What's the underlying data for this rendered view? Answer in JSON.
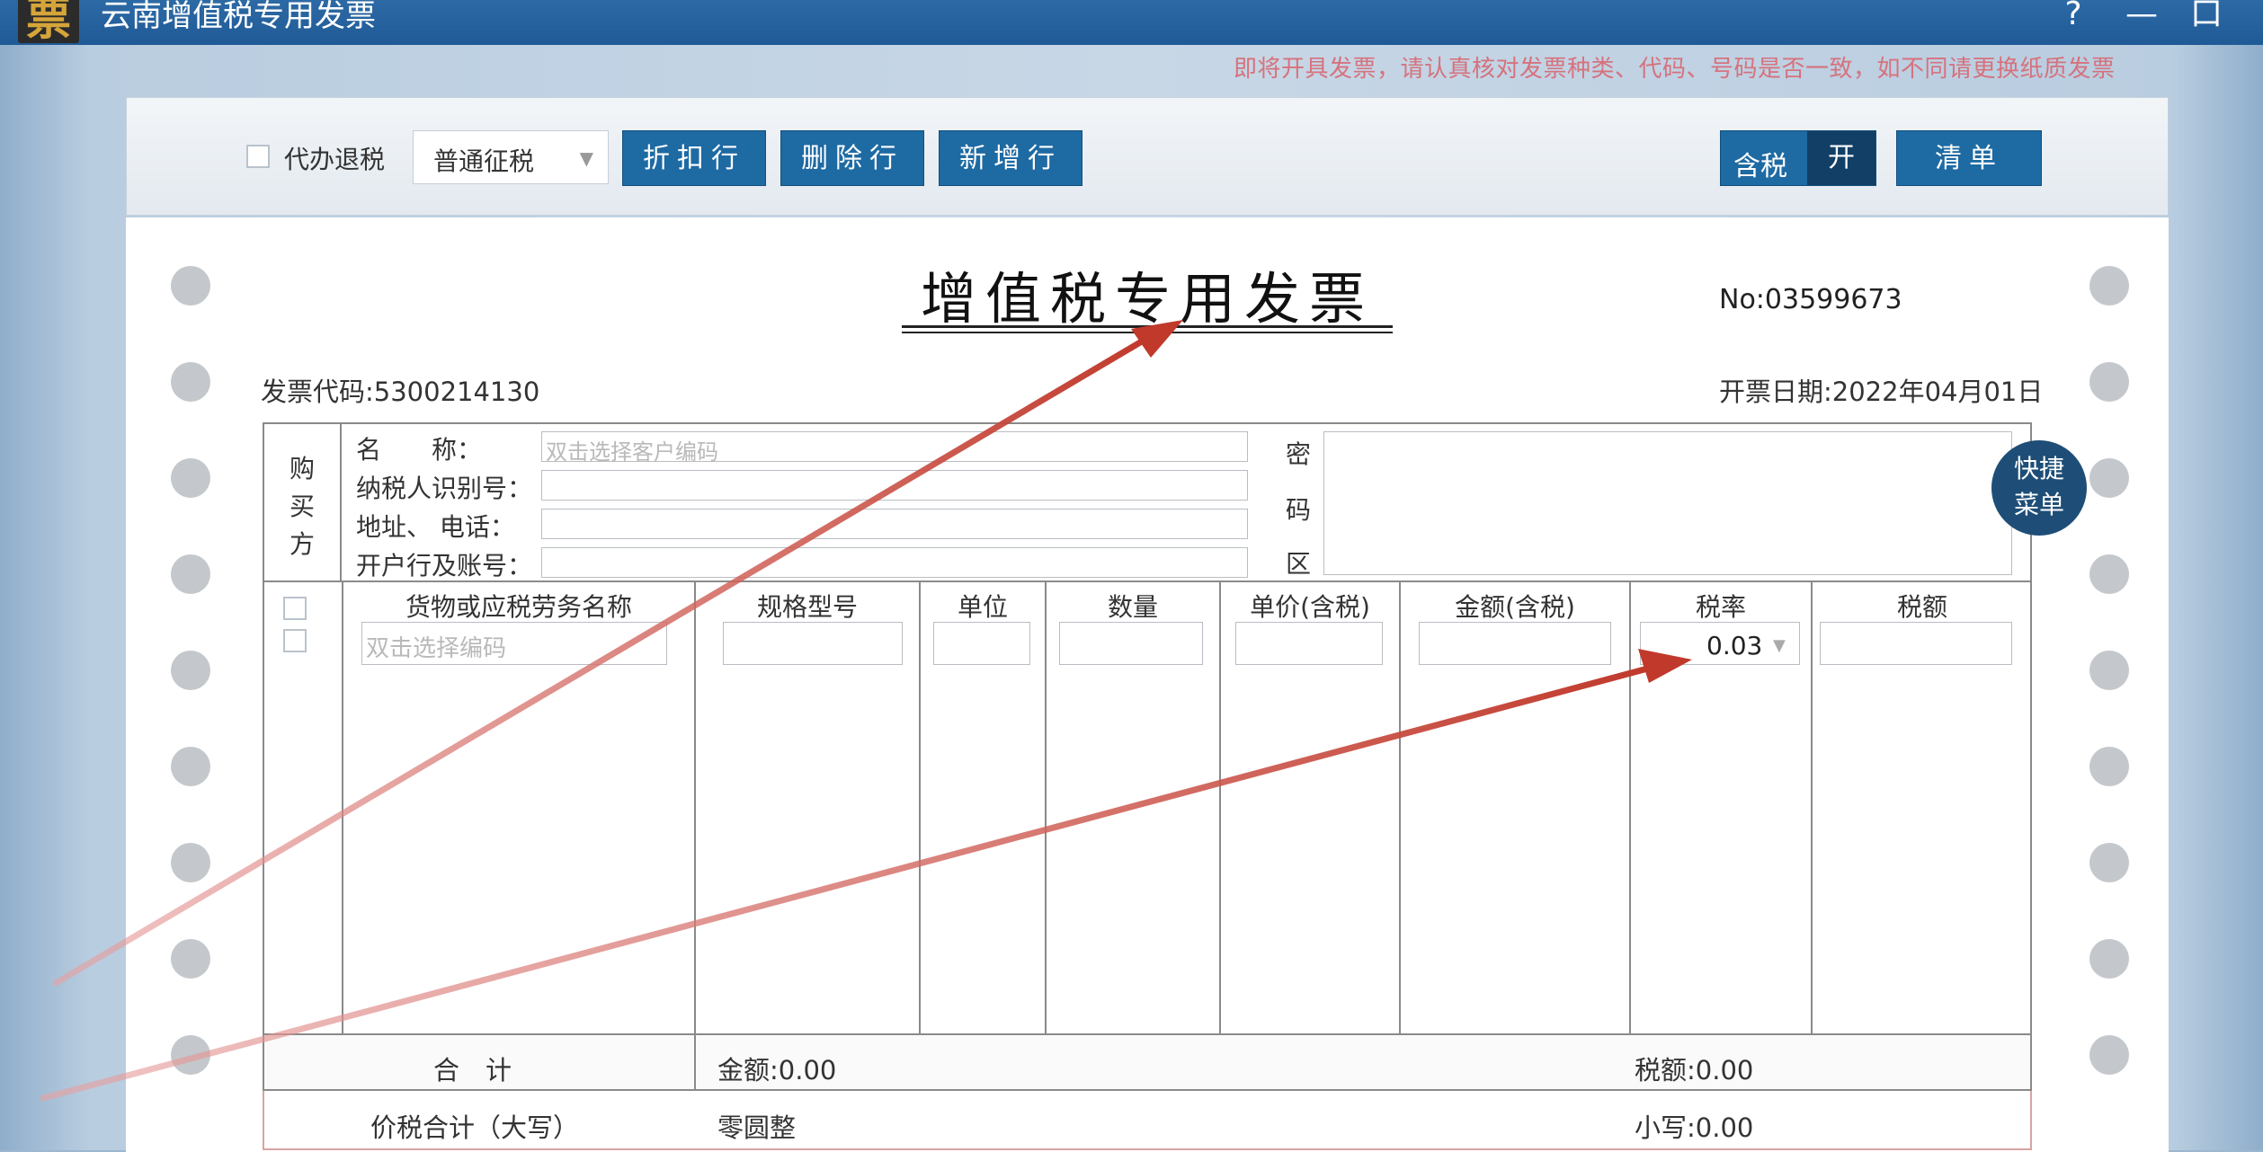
{
  "window": {
    "logo_glyph": "票",
    "title": "云南增值税专用发票",
    "help": "?",
    "minimize": "—",
    "maximize": "口"
  },
  "notice": "即将开具发票，请认真核对发票种类、代码、号码是否一致，如不同请更换纸质发票",
  "toolbar": {
    "proxy_refund_label": "代办退税",
    "tax_type_selected": "普通征税",
    "discount_row": "折扣行",
    "delete_row": "删除行",
    "add_row": "新增行",
    "tax_included_label": "含税",
    "tax_included_state": "开",
    "clear_list": "清单"
  },
  "invoice": {
    "title": "增值税专用发票",
    "number": "No:03599673",
    "code": "发票代码:5300214130",
    "date": "开票日期:2022年04月01日",
    "buyer": {
      "side_label": [
        "购",
        "买",
        "方"
      ],
      "name_label": "名　　称：",
      "name_placeholder": "双击选择客户编码",
      "tax_id_label": "纳税人识别号：",
      "address_phone_label": "地址、 电话：",
      "bank_account_label": "开户行及账号："
    },
    "password_area_label": [
      "密",
      "码",
      "区"
    ],
    "quick_menu": [
      "快捷",
      "菜单"
    ],
    "goods": {
      "columns": [
        "货物或应税劳务名称",
        "规格型号",
        "单位",
        "数量",
        "单价(含税)",
        "金额(含税)",
        "税率",
        "税额"
      ],
      "name_placeholder": "双击选择编码",
      "tax_rate": "0.03"
    },
    "totals": {
      "total_label": "合　计",
      "amount": "金额:0.00",
      "tax": "税额:0.00",
      "grand_total_label": "价税合计（大写）",
      "grand_total_words": "零圆整",
      "grand_total_small": "小写:0.00"
    }
  },
  "colors": {
    "title_bar": "#1f5a96",
    "button": "#1e6aa3",
    "annotation_arrow": "#c0392b",
    "notice_text": "#d6727d"
  }
}
